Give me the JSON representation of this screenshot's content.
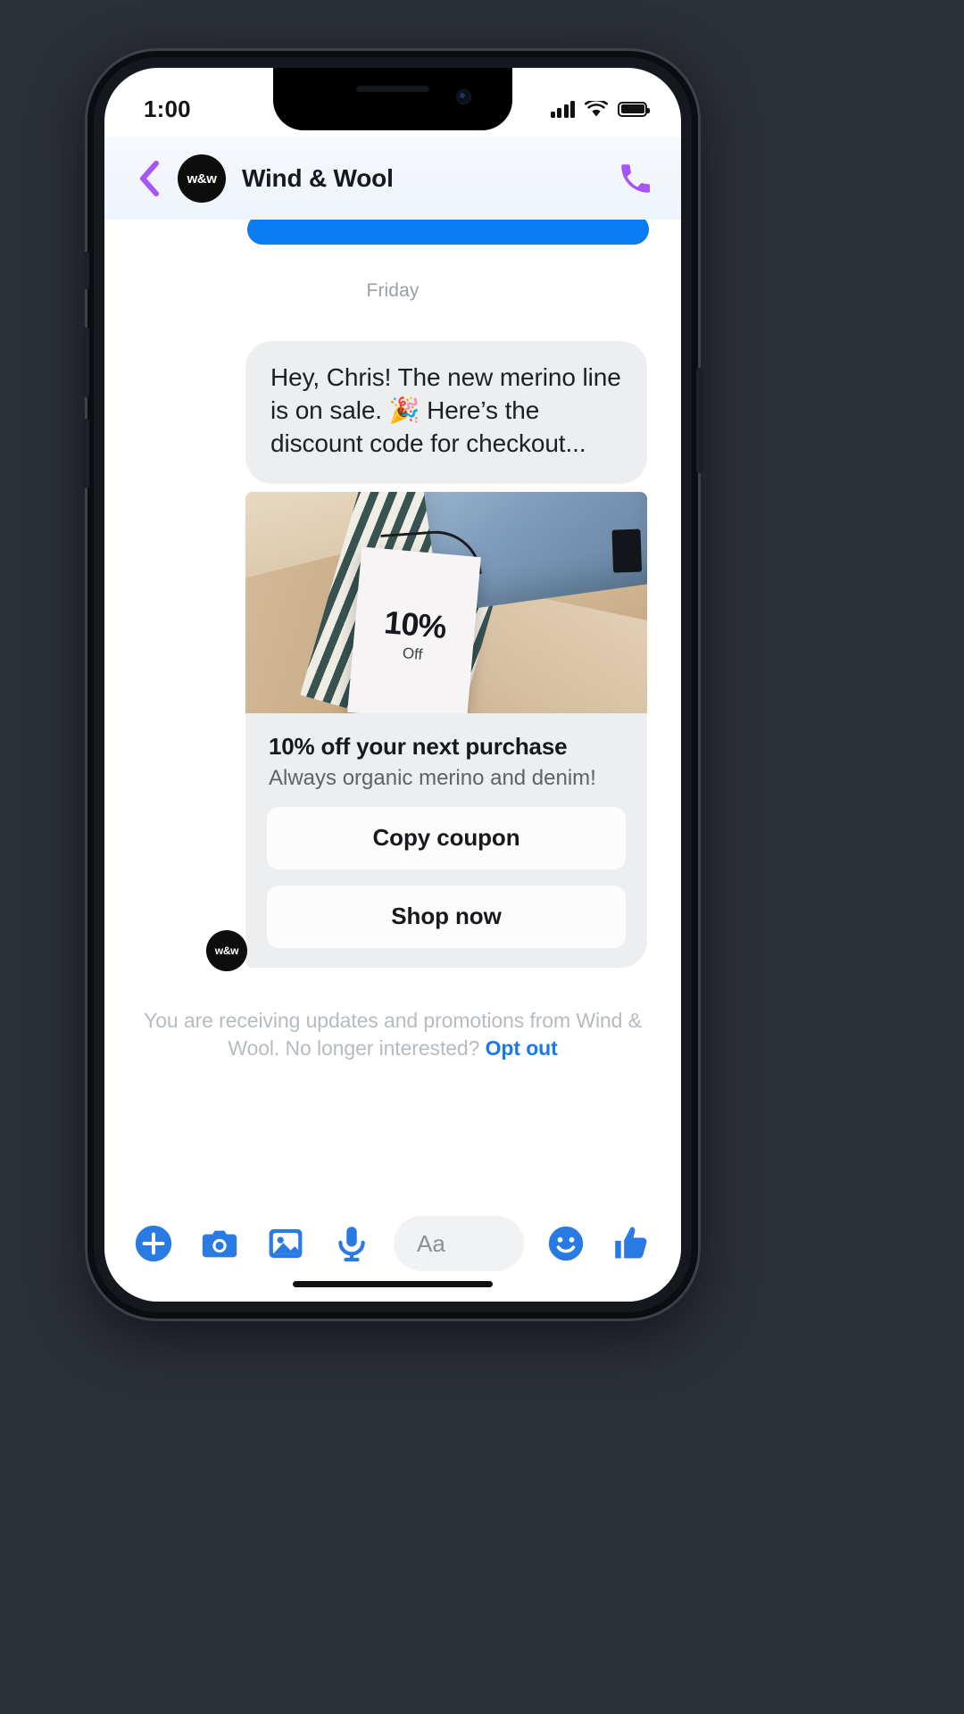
{
  "status_bar": {
    "time": "1:00",
    "signal_icon": "cellular-signal-icon",
    "wifi_icon": "wifi-icon",
    "battery_icon": "battery-full-icon"
  },
  "chat_header": {
    "back_icon": "back-chevron-icon",
    "avatar_initials": "w&w",
    "title": "Wind & Wool",
    "call_icon": "phone-call-icon",
    "back_color": "#a855f7",
    "call_color": "#a855f7"
  },
  "thread": {
    "day_divider": "Friday",
    "incoming_message": "Hey, Chris! The new merino line is on sale. 🎉 Here’s the discount code for checkout...",
    "sender_avatar_initials": "w&w",
    "promo_card": {
      "image_tag_percent": "10%",
      "image_tag_label": "Off",
      "title": "10% off your next purchase",
      "subtitle": "Always organic merino and denim!",
      "buttons": [
        {
          "label": "Copy coupon",
          "name": "copy-coupon-button"
        },
        {
          "label": "Shop now",
          "name": "shop-now-button"
        }
      ]
    },
    "optout": {
      "text": "You are receiving updates and promotions from Wind & Wool. No longer interested? ",
      "link_label": "Opt out",
      "link_color": "#1877f2"
    }
  },
  "composer": {
    "icons_left": [
      {
        "name": "add-plus-icon",
        "label": "plus"
      },
      {
        "name": "camera-icon",
        "label": "camera"
      },
      {
        "name": "photo-gallery-icon",
        "label": "gallery"
      },
      {
        "name": "microphone-icon",
        "label": "microphone"
      }
    ],
    "input_placeholder": "Aa",
    "icons_right": [
      {
        "name": "emoji-smiley-icon",
        "label": "emoji"
      },
      {
        "name": "thumbs-up-icon",
        "label": "like"
      }
    ],
    "accent_color": "#2a7ae4"
  }
}
